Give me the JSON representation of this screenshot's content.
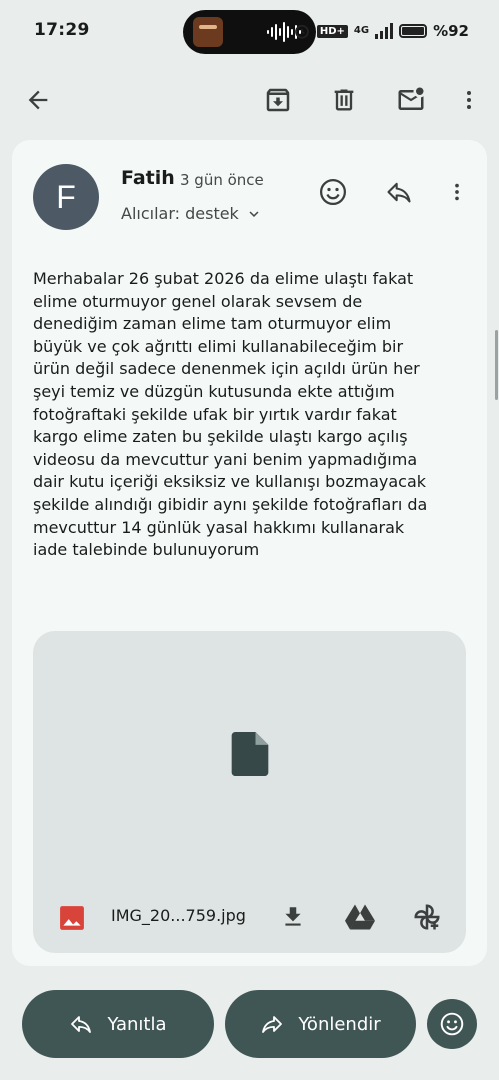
{
  "status": {
    "time": "17:29",
    "network": "4G",
    "hd": "HD+",
    "battery": "%92"
  },
  "toolbar": {
    "back_icon": "arrow-back-icon",
    "archive_icon": "archive-icon",
    "delete_icon": "trash-icon",
    "unread_icon": "mark-unread-icon",
    "more_icon": "more-vert-icon"
  },
  "message": {
    "avatar_letter": "F",
    "sender": "Fatih",
    "time": "3 gün önce",
    "recipients": "Alıcılar: destek",
    "body": "Merhabalar 26 şubat 2026 da  elime ulaştı fakat\nelime oturmuyor genel olarak sevsem de\ndenediğim zaman elime tam oturmuyor elim\nbüyük ve çok ağrıttı elimi kullanabileceğim bir\nürün değil sadece denenmek için açıldı ürün her\nşeyi temiz ve düzgün kutusunda ekte attığım\nfotoğraftaki şekilde ufak bir yırtık vardır fakat\nkargo elime zaten bu şekilde ulaştı kargo açılış\nvideosu da mevcuttur yani benim yapmadığıma\ndair kutu içeriği eksiksiz ve kullanışı bozmayacak\nşekilde alındığı gibidir aynı şekilde fotoğrafları da\nmevcuttur 14 günlük yasal hakkımı kullanarak\niade talebinde bulunuyorum"
  },
  "attachment": {
    "filename": "IMG_20...759.jpg"
  },
  "actions": {
    "reply_label": "Yanıtla",
    "forward_label": "Yönlendir"
  },
  "colors": {
    "background": "#e9eeec",
    "card": "#f4f9f7",
    "accent": "#3f5654",
    "avatar": "#4d5a66",
    "image_icon": "#d9443a"
  }
}
